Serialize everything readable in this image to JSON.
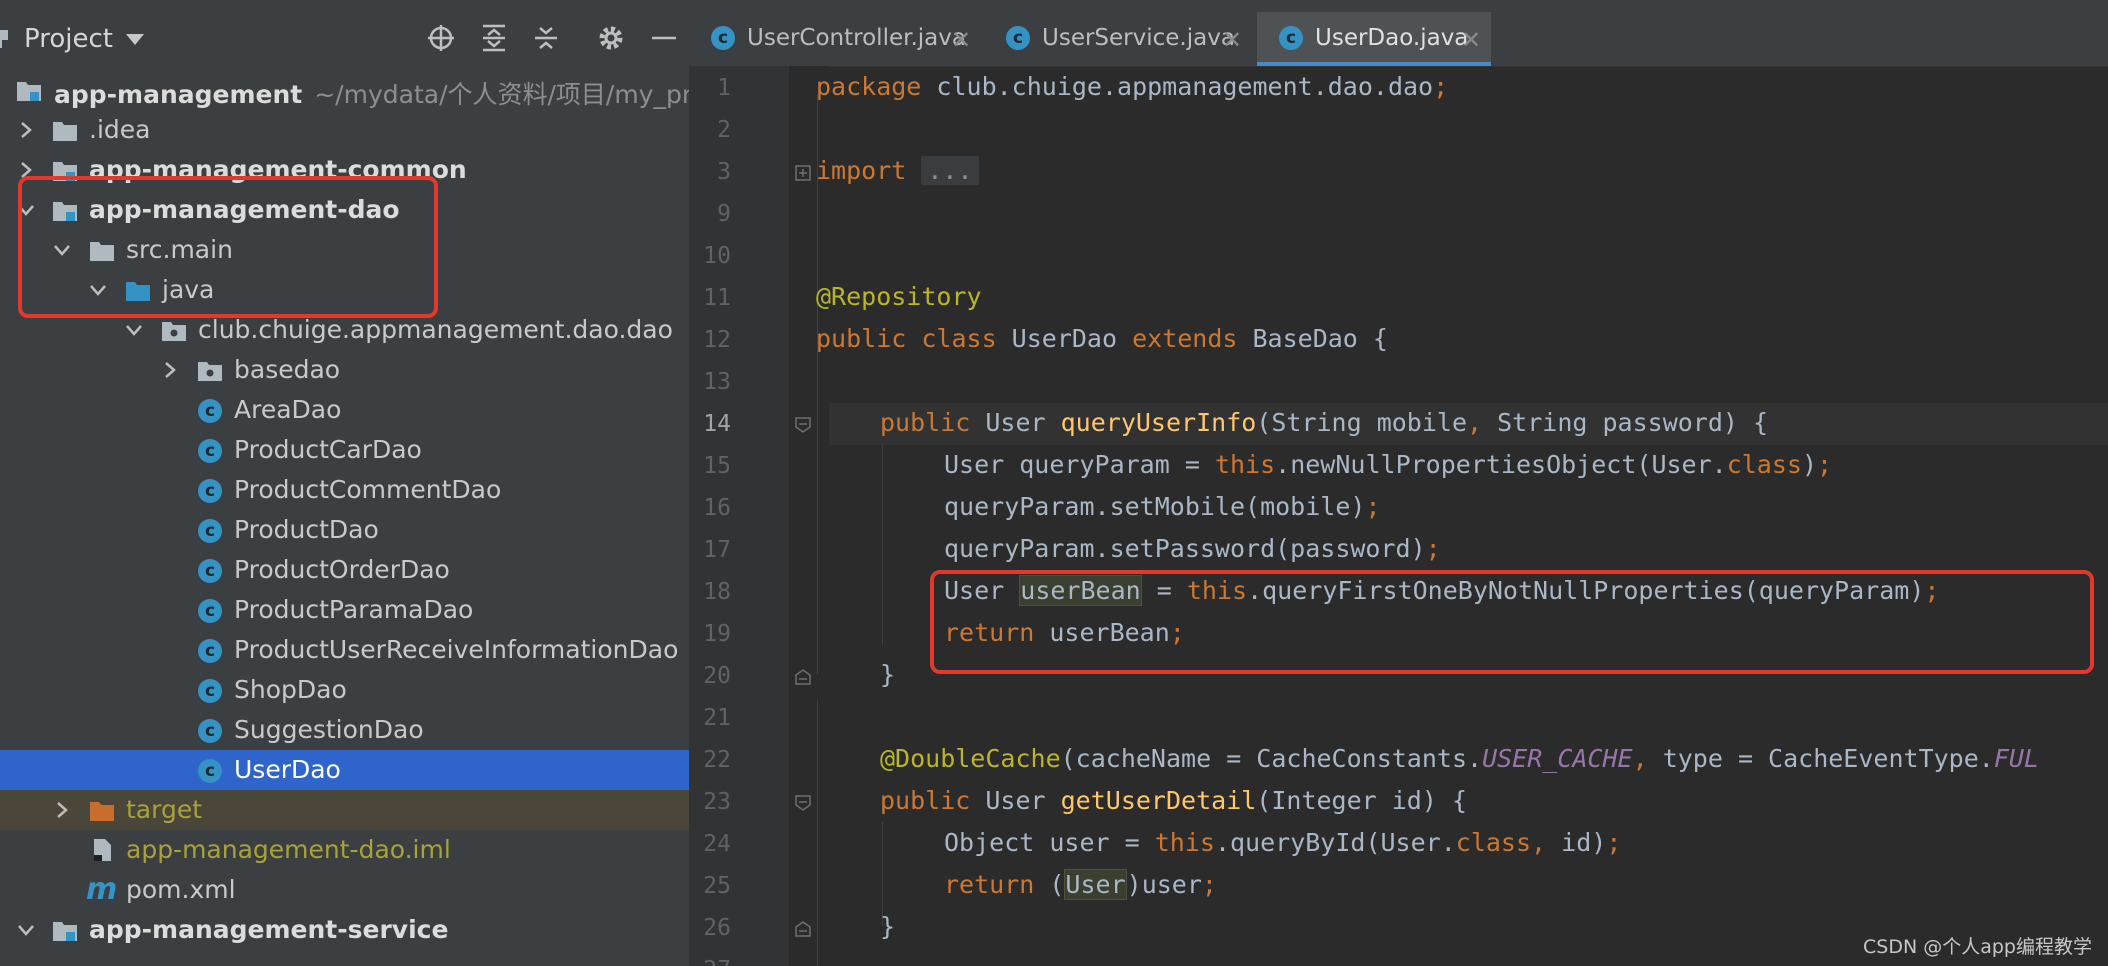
{
  "project_panel": {
    "title": "Project",
    "root": {
      "name": "app-management",
      "path": "~/mydata/个人资料/项目/my_pro"
    },
    "items": [
      {
        "label": ".idea"
      },
      {
        "label": "app-management-common"
      },
      {
        "label": "app-management-dao"
      },
      {
        "label": "src.main"
      },
      {
        "label": "java"
      },
      {
        "label": "club.chuige.appmanagement.dao.dao"
      },
      {
        "label": "basedao"
      },
      {
        "label": "AreaDao"
      },
      {
        "label": "ProductCarDao"
      },
      {
        "label": "ProductCommentDao"
      },
      {
        "label": "ProductDao"
      },
      {
        "label": "ProductOrderDao"
      },
      {
        "label": "ProductParamaDao"
      },
      {
        "label": "ProductUserReceiveInformationDao"
      },
      {
        "label": "ShopDao"
      },
      {
        "label": "SuggestionDao"
      },
      {
        "label": "UserDao"
      },
      {
        "label": "target"
      },
      {
        "label": "app-management-dao.iml"
      },
      {
        "label": "pom.xml"
      },
      {
        "label": "app-management-service"
      }
    ]
  },
  "tabs": [
    {
      "label": "UserController.java",
      "icon": "class-icon"
    },
    {
      "label": "UserService.java",
      "icon": "class-icon"
    },
    {
      "label": "UserDao.java",
      "icon": "class-icon"
    }
  ],
  "editor": {
    "line_numbers": [
      "1",
      "2",
      "3",
      "9",
      "10",
      "11",
      "12",
      "13",
      "14",
      "15",
      "16",
      "17",
      "18",
      "19",
      "20",
      "21",
      "22",
      "23",
      "24",
      "25",
      "26",
      "27"
    ],
    "current_line": "14",
    "lines": {
      "l1_kw": "package",
      "l1_rest": " club.chuige.appmanagement.dao.dao",
      "l1_semi": ";",
      "l3_kw": "import",
      "l3_fold": "...",
      "l11_ann": "@Repository",
      "l12_kw1": "public class",
      "l12_a": " UserDao ",
      "l12_kw2": "extends",
      "l12_b": " BaseDao {",
      "l14_kw": "public",
      "l14_a": " User ",
      "l14_fn": "queryUserInfo",
      "l14_b": "(String mobile",
      "l14_comma": ",",
      "l14_c": " String password) {",
      "l15_a": "User queryParam = ",
      "l15_kw": "this",
      "l15_b": ".newNullPropertiesObject(User.",
      "l15_kw2": "class",
      "l15_c": ")",
      "l15_semi": ";",
      "l16_a": "queryParam.setMobile(mobile)",
      "l16_semi": ";",
      "l17_a": "queryParam.setPassword(password)",
      "l17_semi": ";",
      "l18_a": "User ",
      "l18_hl": "userBean",
      "l18_b": " = ",
      "l18_kw": "this",
      "l18_c": ".queryFirstOneByNotNullProperties(queryParam)",
      "l18_semi": ";",
      "l19_kw": "return",
      "l19_a": " userBean",
      "l19_semi": ";",
      "l20_a": "}",
      "l22_ann": "@DoubleCache",
      "l22_a": "(cacheName = CacheConstants.",
      "l22_fld": "USER_CACHE",
      "l22_comma": ",",
      "l22_b": " type = CacheEventType.",
      "l22_fld2": "FUL",
      "l23_kw": "public",
      "l23_a": " User ",
      "l23_fn": "getUserDetail",
      "l23_b": "(Integer id) {",
      "l24_a": "Object user = ",
      "l24_kw": "this",
      "l24_b": ".queryById(User.",
      "l24_kw2": "class",
      "l24_comma": ",",
      "l24_c": " id)",
      "l24_semi": ";",
      "l25_kw": "return",
      "l25_a": " (",
      "l25_hl": "User",
      "l25_b": ")user",
      "l25_semi": ";",
      "l26_a": "}"
    }
  },
  "watermark": "CSDN @个人app编程教学",
  "colors": {
    "highlight_box": "#e3382c",
    "selection": "#2f65ca",
    "keyword": "#cc7832",
    "annotation": "#bbb529",
    "method": "#ffc66d",
    "static_field": "#9876aa"
  }
}
